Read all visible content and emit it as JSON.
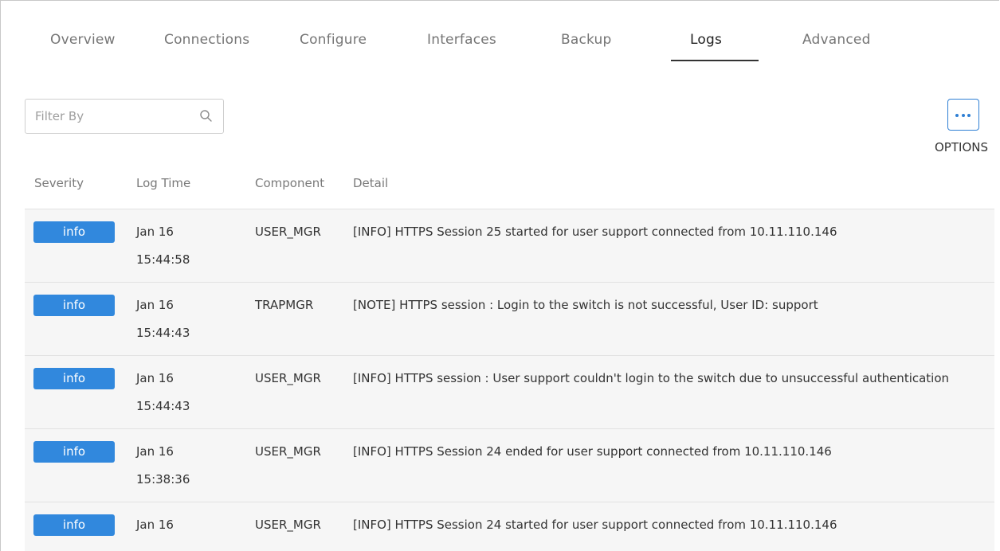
{
  "tabs": [
    {
      "label": "Overview",
      "active": false
    },
    {
      "label": "Connections",
      "active": false
    },
    {
      "label": "Configure",
      "active": false
    },
    {
      "label": "Interfaces",
      "active": false
    },
    {
      "label": "Backup",
      "active": false
    },
    {
      "label": "Logs",
      "active": true
    },
    {
      "label": "Advanced",
      "active": false
    }
  ],
  "filter": {
    "placeholder": "Filter By",
    "value": ""
  },
  "options": {
    "label": "OPTIONS"
  },
  "table": {
    "headers": {
      "severity": "Severity",
      "log_time": "Log Time",
      "component": "Component",
      "detail": "Detail"
    },
    "rows": [
      {
        "severity": "info",
        "date": "Jan 16",
        "time": "15:44:58",
        "component": "USER_MGR",
        "detail": "[INFO] HTTPS Session 25 started for user support connected from 10.11.110.146"
      },
      {
        "severity": "info",
        "date": "Jan 16",
        "time": "15:44:43",
        "component": "TRAPMGR",
        "detail": "[NOTE] HTTPS session : Login to the switch is not successful, User ID: support"
      },
      {
        "severity": "info",
        "date": "Jan 16",
        "time": "15:44:43",
        "component": "USER_MGR",
        "detail": "[INFO] HTTPS session : User support couldn't login to the switch due to unsuccessful authentication"
      },
      {
        "severity": "info",
        "date": "Jan 16",
        "time": "15:38:36",
        "component": "USER_MGR",
        "detail": "[INFO] HTTPS Session 24 ended for user support connected from 10.11.110.146"
      },
      {
        "severity": "info",
        "date": "Jan 16",
        "time": "",
        "component": "USER_MGR",
        "detail": "[INFO] HTTPS Session 24 started for user support connected from 10.11.110.146"
      }
    ]
  },
  "colors": {
    "accent": "#3188dd",
    "row_bg": "#f6f6f6"
  }
}
